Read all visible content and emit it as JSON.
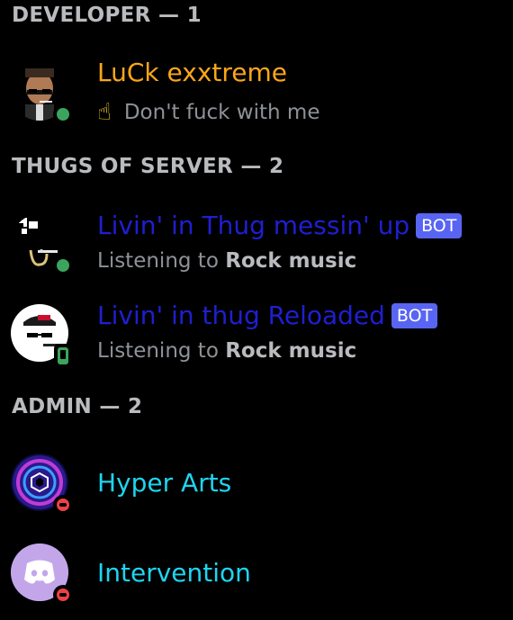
{
  "sections": [
    {
      "header": "DEVELOPER — 1",
      "members": [
        {
          "name": "LuCk exxtreme",
          "name_color": "#faa61a",
          "bot": false,
          "status": "online",
          "activity_emoji": "☝",
          "activity_text": "Don't fuck with me",
          "avatar_icon": "gangster-avatar-icon"
        }
      ]
    },
    {
      "header": "THUGS OF SERVER — 2",
      "members": [
        {
          "name": "Livin' in Thug messin' up",
          "name_color": "#1f1fd1",
          "bot": true,
          "bot_label": "BOT",
          "status": "online",
          "activity_prefix": "Listening to",
          "activity_strong": "Rock music",
          "avatar_icon": "thug-life-avatar-icon"
        },
        {
          "name": "Livin' in thug Reloaded",
          "name_color": "#1f1fd1",
          "bot": true,
          "bot_label": "BOT",
          "status": "mobile-online",
          "activity_prefix": "Listening to",
          "activity_strong": "Rock music",
          "avatar_icon": "thug-cap-avatar-icon"
        }
      ]
    },
    {
      "header": "ADMIN — 2",
      "members": [
        {
          "name": "Hyper Arts",
          "name_color": "#1ed5f0",
          "bot": false,
          "status": "dnd",
          "avatar_icon": "hexagon-tunnel-avatar-icon"
        },
        {
          "name": "Intervention",
          "name_color": "#1ed5f0",
          "bot": false,
          "status": "dnd",
          "avatar_icon": "discord-logo-avatar-icon"
        }
      ]
    }
  ]
}
